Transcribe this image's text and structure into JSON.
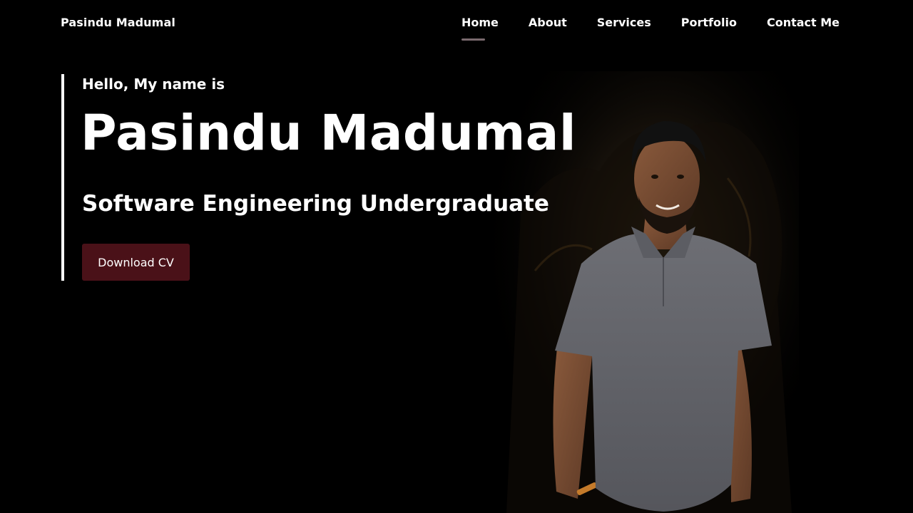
{
  "nav": {
    "brand": "Pasindu Madumal",
    "items": [
      {
        "label": "Home",
        "active": true
      },
      {
        "label": "About",
        "active": false
      },
      {
        "label": "Services",
        "active": false
      },
      {
        "label": "Portfolio",
        "active": false
      },
      {
        "label": "Contact Me",
        "active": false
      }
    ]
  },
  "hero": {
    "greeting": "Hello, My name is",
    "name": "Pasindu Madumal",
    "role": "Software Engineering Undergraduate",
    "cv_button": "Download CV"
  },
  "colors": {
    "background": "#000000",
    "accent": "#4a1118",
    "nav_underline": "#7a6a6e"
  }
}
